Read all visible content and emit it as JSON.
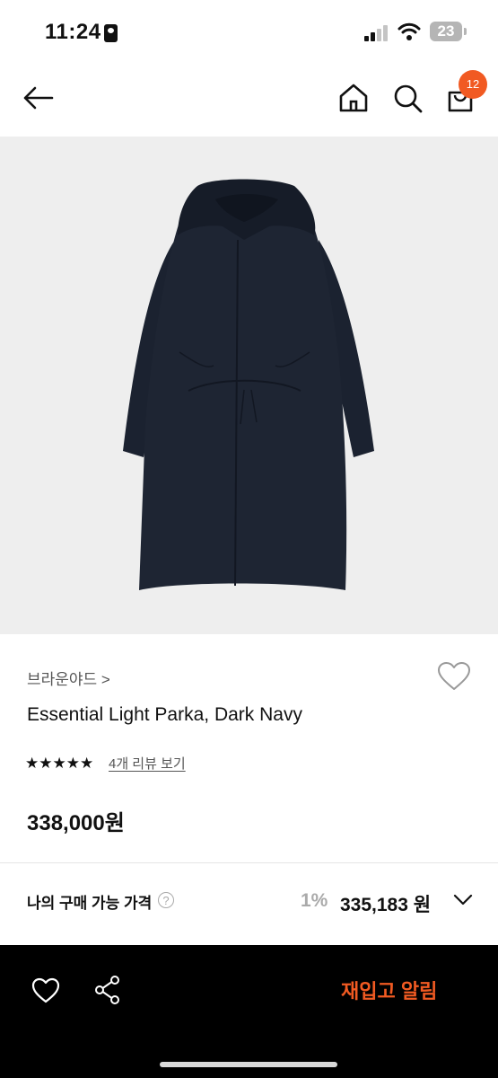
{
  "status_bar": {
    "time": "11:24",
    "battery": "23"
  },
  "header": {
    "cart_count": "12"
  },
  "product": {
    "brand": "브라운야드 >",
    "title": "Essential Light Parka, Dark Navy",
    "rating_stars": "★★★★★",
    "review_link": "4개 리뷰 보기",
    "price": "338,000원"
  },
  "purchase": {
    "label": "나의 구매 가능 가격",
    "help": "?",
    "discount": "1%",
    "final_price": "335,183 원"
  },
  "bottom_bar": {
    "restock_label": "재입고 알림"
  },
  "colors": {
    "accent": "#f15a22",
    "garment": "#1b2230",
    "image_bg": "#eeeeee"
  }
}
